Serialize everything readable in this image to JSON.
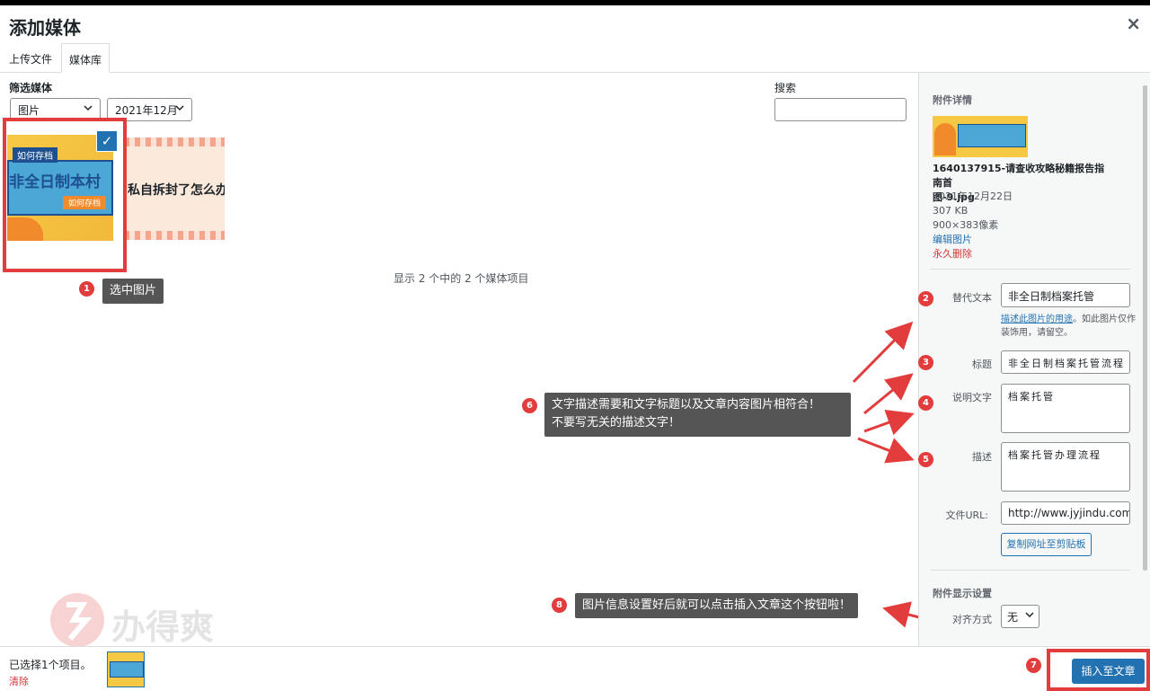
{
  "modal": {
    "title": "添加媒体",
    "close": "×"
  },
  "tabs": [
    {
      "label": "上传文件"
    },
    {
      "label": "媒体库"
    }
  ],
  "filter": {
    "label": "筛选媒体",
    "type_value": "图片",
    "date_value": "2021年12月"
  },
  "search": {
    "label": "搜索",
    "value": ""
  },
  "thumbs": {
    "t1_badge": "如何存档",
    "t1_main": "非全日制本村",
    "t1_btn": "如何存档",
    "t2_text": "私自拆封了怎么办"
  },
  "count_text": "显示 2 个中的 2 个媒体项目",
  "annotations": {
    "a1": {
      "num": "1",
      "text": "选中图片"
    },
    "a2": {
      "num": "2"
    },
    "a3": {
      "num": "3"
    },
    "a4": {
      "num": "4"
    },
    "a5": {
      "num": "5"
    },
    "a6": {
      "num": "6",
      "line1": "文字描述需要和文字标题以及文章内容图片相符合！",
      "line2": "不要写无关的描述文字！"
    },
    "a7": {
      "num": "7"
    },
    "a8": {
      "num": "8",
      "text": "图片信息设置好后就可以点击插入文章这个按钮啦！"
    }
  },
  "sidebar": {
    "heading": "附件详情",
    "filename_line1": "1640137915-请查收攻略秘籍报告指南首",
    "filename_line2": "图-9.jpg",
    "date": "2021年12月22日",
    "size": "307 KB",
    "dimensions": "900×383像素",
    "edit_link": "编辑图片",
    "delete_link": "永久删除",
    "alt_label": "替代文本",
    "alt_value": "非全日制档案托管",
    "alt_help_link": "描述此图片的用途",
    "alt_help_rest": "。如此图片仅作装饰用，请留空。",
    "title_label": "标题",
    "title_value": "非全日制档案托管流程",
    "caption_label": "说明文字",
    "caption_value": "档案托管",
    "desc_label": "描述",
    "desc_value": "档案托管办理流程",
    "url_label": "文件URL:",
    "url_value": "http://www.jyjindu.com/w",
    "copy_button": "复制网址至剪贴板",
    "display_heading": "附件显示设置",
    "align_label": "对齐方式",
    "align_value": "无"
  },
  "footer": {
    "selected": "已选择1个项目。",
    "clear": "清除",
    "insert": "插入至文章"
  },
  "watermark": {
    "text": "办得爽"
  },
  "colors": {
    "accent": "#2271b1",
    "annotation_red": "#e23c3c",
    "callout_bg": "#555555"
  }
}
